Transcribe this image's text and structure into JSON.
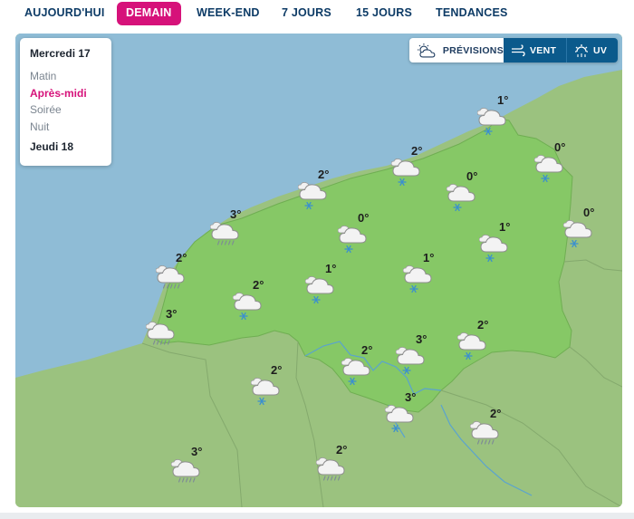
{
  "tabs": [
    {
      "label": "AUJOURD'HUI",
      "active": false
    },
    {
      "label": "DEMAIN",
      "active": true
    },
    {
      "label": "WEEK-END",
      "active": false
    },
    {
      "label": "7 JOURS",
      "active": false
    },
    {
      "label": "15 JOURS",
      "active": false
    },
    {
      "label": "TENDANCES",
      "active": false
    }
  ],
  "day_panel": {
    "title": "Mercredi 17",
    "periods": [
      "Matin",
      "Après-midi",
      "Soirée",
      "Nuit"
    ],
    "active_period": "Après-midi",
    "next_day": "Jeudi 18"
  },
  "layers": {
    "forecast": "PRÉVISIONS",
    "wind": "VENT",
    "uv": "UV"
  },
  "colors": {
    "accent": "#d6127a",
    "tab_text": "#0d3b66",
    "sea": "#8fbcd6",
    "region": "#86c866",
    "land": "#9bc27f",
    "layer_active": "#0b5a8c"
  },
  "stations": [
    {
      "temp": "1°",
      "icon": "snow"
    },
    {
      "temp": "0°",
      "icon": "snow"
    },
    {
      "temp": "2°",
      "icon": "snow"
    },
    {
      "temp": "0°",
      "icon": "snow"
    },
    {
      "temp": "2°",
      "icon": "snow"
    },
    {
      "temp": "0°",
      "icon": "snow"
    },
    {
      "temp": "3°",
      "icon": "rain"
    },
    {
      "temp": "0°",
      "icon": "snow"
    },
    {
      "temp": "1°",
      "icon": "snow"
    },
    {
      "temp": "2°",
      "icon": "rain"
    },
    {
      "temp": "1°",
      "icon": "snow"
    },
    {
      "temp": "2°",
      "icon": "snow"
    },
    {
      "temp": "1°",
      "icon": "snow"
    },
    {
      "temp": "3°",
      "icon": "rain"
    },
    {
      "temp": "3°",
      "icon": "snow"
    },
    {
      "temp": "2°",
      "icon": "snow"
    },
    {
      "temp": "2°",
      "icon": "snow"
    },
    {
      "temp": "2°",
      "icon": "snow"
    },
    {
      "temp": "3°",
      "icon": "snow"
    },
    {
      "temp": "2°",
      "icon": "rain"
    },
    {
      "temp": "3°",
      "icon": "rain"
    },
    {
      "temp": "2°",
      "icon": "rain"
    }
  ]
}
